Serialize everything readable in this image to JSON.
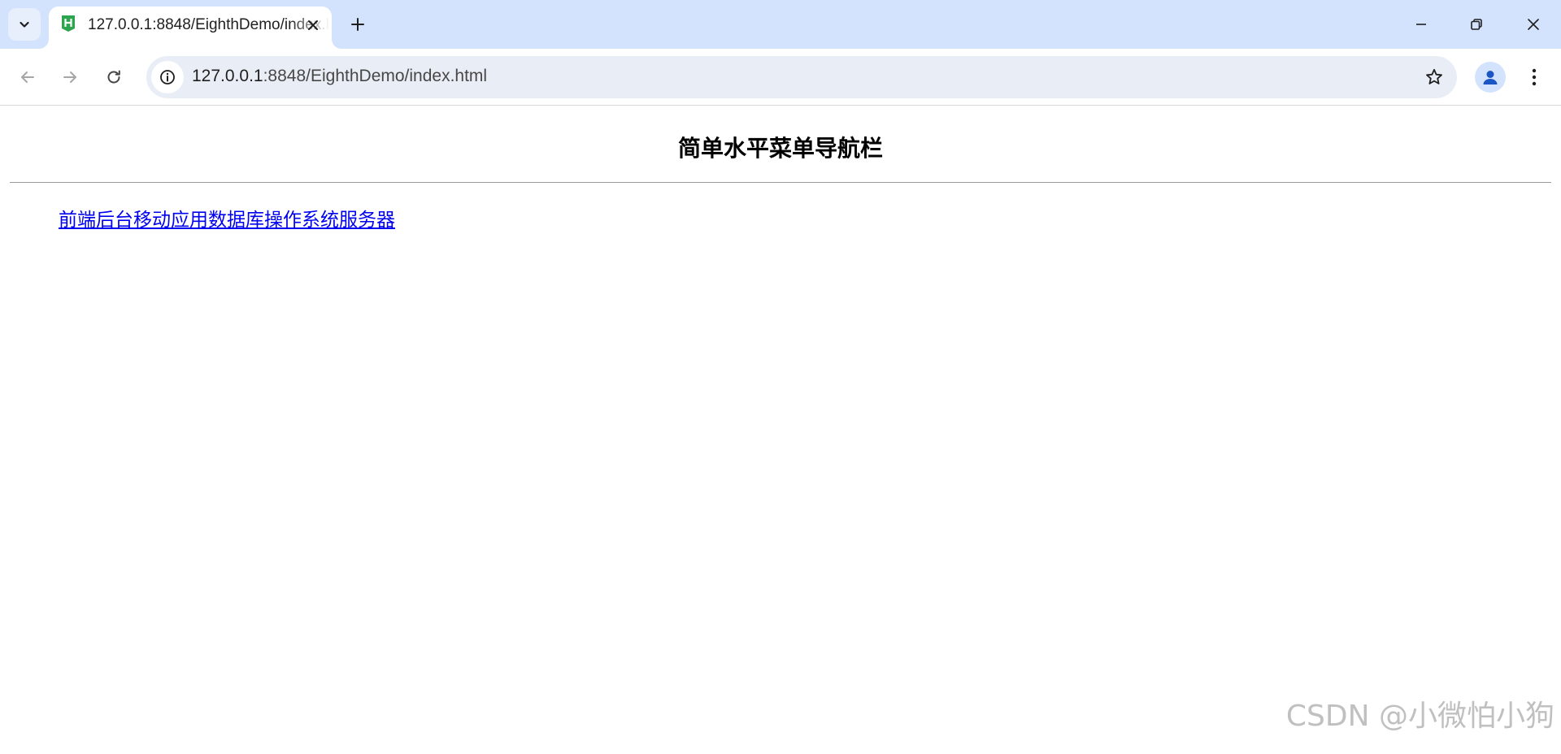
{
  "browser": {
    "tab": {
      "title": "127.0.0.1:8848/EighthDemo/index.html",
      "favicon": "hbuilder-h-icon"
    },
    "url": {
      "host": "127.0.0.1",
      "path": ":8848/EighthDemo/index.html"
    },
    "icons": {
      "tab_search": "chevron-down-icon",
      "tab_close": "close-icon",
      "new_tab": "plus-icon",
      "minimize": "minimize-icon",
      "restore": "restore-icon",
      "close_window": "close-icon",
      "back": "arrow-left-icon",
      "forward": "arrow-right-icon",
      "reload": "reload-icon",
      "site_info": "info-icon",
      "bookmark": "star-icon",
      "profile": "person-icon",
      "menu": "kebab-menu-icon"
    },
    "colors": {
      "tabstrip": "#d3e3fd",
      "omnibox": "#e9eef6",
      "favicon": "#2da44e"
    }
  },
  "page": {
    "title": "简单水平菜单导航栏",
    "nav_items": [
      "前端",
      "后台",
      "移动应用",
      "数据库",
      "操作系统",
      "服务器"
    ],
    "link_color": "#0000ee"
  },
  "watermark": "CSDN @小微怕小狗"
}
